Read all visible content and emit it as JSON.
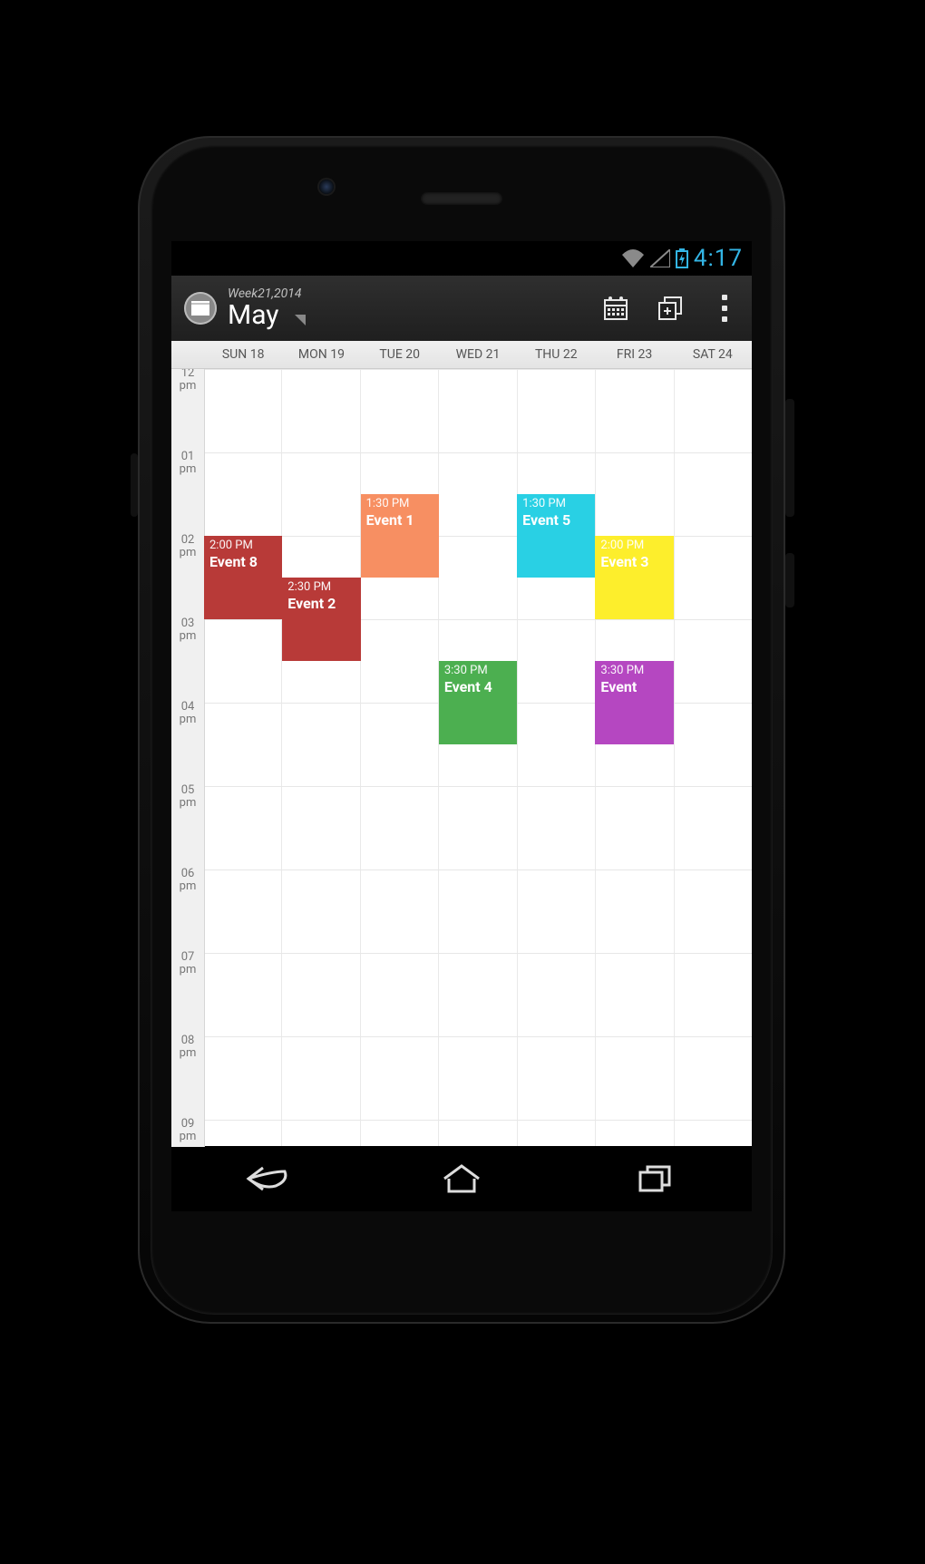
{
  "statusbar": {
    "time": "4:17"
  },
  "actionbar": {
    "subtitle": "Week21,2014",
    "title": "May"
  },
  "week": {
    "days": [
      "SUN 18",
      "MON 19",
      "TUE 20",
      "WED 21",
      "THU 22",
      "FRI 23",
      "SAT 24"
    ],
    "hours": [
      "12 pm",
      "01 pm",
      "02 pm",
      "03 pm",
      "04 pm",
      "05 pm",
      "06 pm",
      "07 pm",
      "08 pm",
      "09 pm"
    ],
    "hour_start_index": 12
  },
  "events": [
    {
      "day": 0,
      "start": 14.0,
      "end": 15.0,
      "time": "2:00 PM",
      "title": "Event 8",
      "color": "red"
    },
    {
      "day": 1,
      "start": 14.5,
      "end": 15.5,
      "time": "2:30 PM",
      "title": "Event 2",
      "color": "red"
    },
    {
      "day": 2,
      "start": 13.5,
      "end": 14.5,
      "time": "1:30 PM",
      "title": "Event 1",
      "color": "orange"
    },
    {
      "day": 3,
      "start": 15.5,
      "end": 16.5,
      "time": "3:30 PM",
      "title": "Event 4",
      "color": "green"
    },
    {
      "day": 4,
      "start": 13.5,
      "end": 14.5,
      "time": "1:30 PM",
      "title": "Event 5",
      "color": "cyan"
    },
    {
      "day": 5,
      "start": 14.0,
      "end": 15.0,
      "time": "2:00 PM",
      "title": "Event 3",
      "color": "yellow"
    },
    {
      "day": 5,
      "start": 15.5,
      "end": 16.5,
      "time": "3:30 PM",
      "title": "Event",
      "color": "purple"
    }
  ]
}
